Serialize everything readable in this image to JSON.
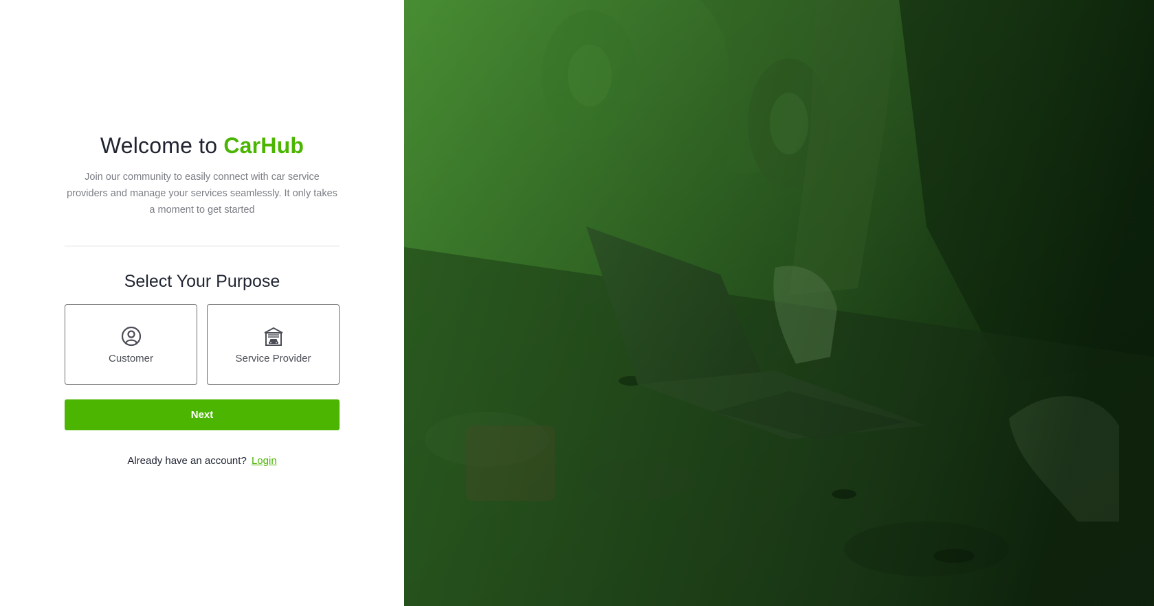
{
  "welcome": {
    "prefix": "Welcome to ",
    "brand": "CarHub",
    "subtitle": "Join our community to easily connect with car service providers and manage your services seamlessly. It only takes a moment to get started"
  },
  "purpose": {
    "title": "Select Your Purpose",
    "options": [
      {
        "label": "Customer",
        "icon": "user-circle-icon"
      },
      {
        "label": "Service Provider",
        "icon": "garage-icon"
      }
    ]
  },
  "actions": {
    "next_label": "Next"
  },
  "login": {
    "prompt": "Already have an account?",
    "link_label": "Login"
  },
  "hero": {
    "image": "mechanic-with-laptop-over-car-engine-photo",
    "overlay_color": "#2f7a1f"
  },
  "colors": {
    "accent": "#4bb502",
    "text_dark": "#1f2430",
    "text_muted": "#7a7d84"
  }
}
